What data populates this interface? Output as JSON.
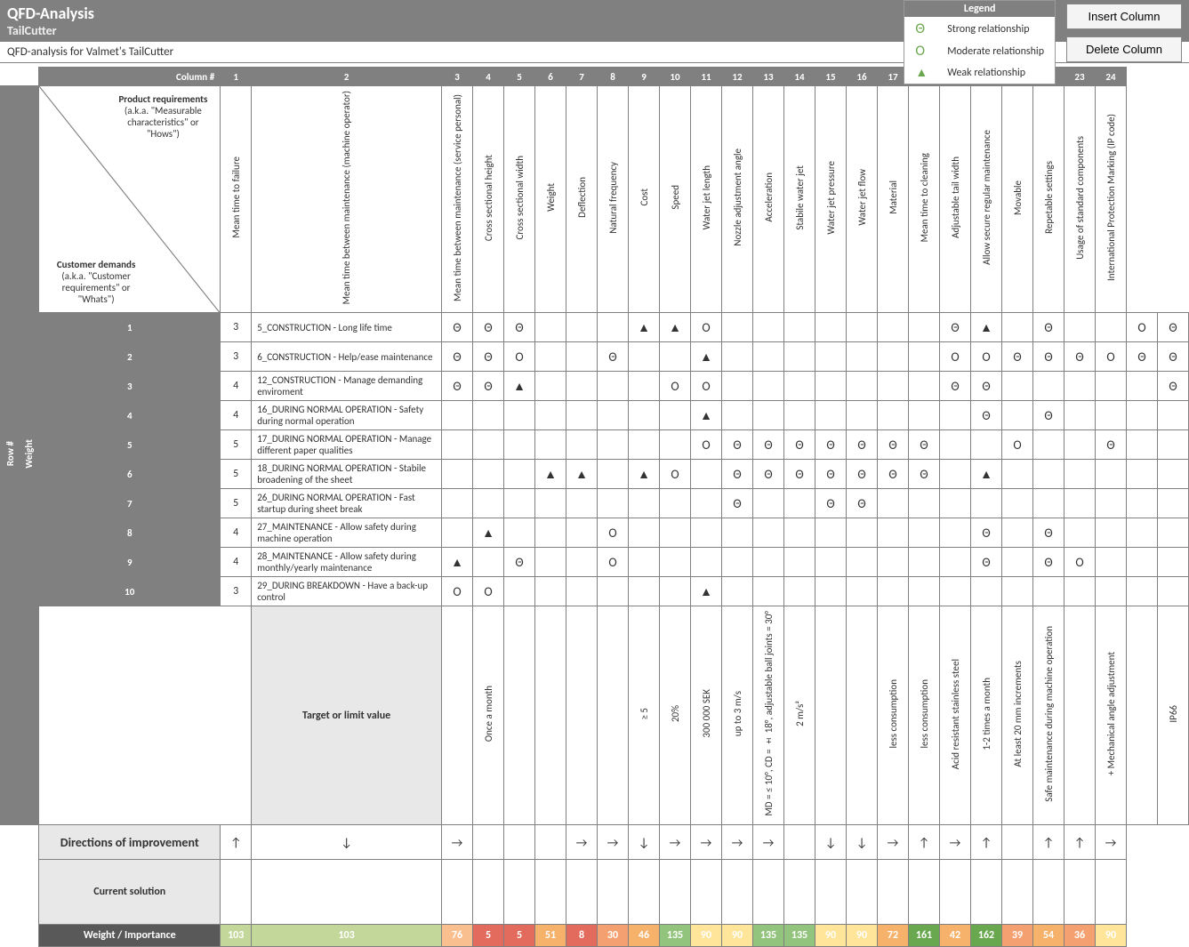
{
  "header": {
    "title": "QFD-Analysis",
    "subtitle": "TailCutter",
    "desc": "QFD-analysis for Valmet's TailCutter"
  },
  "buttons": {
    "insert": "Insert Column",
    "delete": "Delete Column"
  },
  "legend": {
    "title": "Legend",
    "strong": "Strong relationship",
    "moderate": "Moderate relationship",
    "weak": "Weak relationship"
  },
  "cornerLabels": {
    "productReq": "Product requirements",
    "productReqSub": "(a.k.a. \"Measurable characteristics\" or \"Hows\")",
    "custDem": "Customer demands",
    "custDemSub": "(a.k.a. \"Customer requirements\" or \"Whats\")"
  },
  "axis": {
    "columnNum": "Column #",
    "rowNum": "Row #",
    "weight": "Weight"
  },
  "rowLabels": {
    "target": "Target or limit value",
    "direction": "Directions of improvement",
    "current": "Current solution",
    "importance": "Weight / Importance"
  },
  "symbols": {
    "strong": "Θ",
    "moderate": "Ο",
    "weak": "▲"
  },
  "columns": [
    {
      "n": 1,
      "name": "Mean time to failure",
      "target": "",
      "dir": "↑",
      "imp": 103,
      "clr": "#c4d79b"
    },
    {
      "n": 2,
      "name": "Mean time between maintenance (machine operator)",
      "target": "Once a month",
      "dir": "↓",
      "imp": 103,
      "clr": "#c4d79b"
    },
    {
      "n": 3,
      "name": "Mean time between maintenance (service personal)",
      "target": "",
      "dir": "→",
      "imp": 76,
      "clr": "#fabf8f"
    },
    {
      "n": 4,
      "name": "Cross sectional height",
      "target": "",
      "dir": "",
      "imp": 5,
      "clr": "#e26b5d"
    },
    {
      "n": 5,
      "name": "Cross sectional width",
      "target": "",
      "dir": "",
      "imp": 5,
      "clr": "#e26b5d"
    },
    {
      "n": 6,
      "name": "Weight",
      "target": "",
      "dir": "",
      "imp": 51,
      "clr": "#f6b26b"
    },
    {
      "n": 7,
      "name": "Deflection",
      "target": "≥ 5",
      "dir": "→",
      "imp": 8,
      "clr": "#e26b5d"
    },
    {
      "n": 8,
      "name": "Natural frequency",
      "target": "20%",
      "dir": "→",
      "imp": 30,
      "clr": "#f4a070"
    },
    {
      "n": 9,
      "name": "Cost",
      "target": "300 000 SEK",
      "dir": "↓",
      "imp": 46,
      "clr": "#f6b26b"
    },
    {
      "n": 10,
      "name": "Speed",
      "target": "up to 3 m/s",
      "dir": "→",
      "imp": 135,
      "clr": "#93c47d"
    },
    {
      "n": 11,
      "name": "Water jet length",
      "target": "MD = ≤ 10°, CD = ± 18°, adjustable ball joints = 30°",
      "dir": "→",
      "imp": 90,
      "clr": "#ffe599"
    },
    {
      "n": 12,
      "name": "Nozzle adjustment angle",
      "target": "2 m/s²",
      "dir": "→",
      "imp": 90,
      "clr": "#ffe599"
    },
    {
      "n": 13,
      "name": "Acceleration",
      "target": "",
      "dir": "→",
      "imp": 135,
      "clr": "#93c47d"
    },
    {
      "n": 14,
      "name": "Stabile water jet",
      "target": "",
      "dir": "",
      "imp": 135,
      "clr": "#93c47d"
    },
    {
      "n": 15,
      "name": "Water jet pressure",
      "target": "less consumption",
      "dir": "↓",
      "imp": 90,
      "clr": "#ffe599"
    },
    {
      "n": 16,
      "name": "Water jet flow",
      "target": "less consumption",
      "dir": "↓",
      "imp": 90,
      "clr": "#ffe599"
    },
    {
      "n": 17,
      "name": "Material",
      "target": "Acid resistant stainless steel",
      "dir": "→",
      "imp": 72,
      "clr": "#f6b26b"
    },
    {
      "n": 18,
      "name": "Mean time to cleaning",
      "target": "1-2 times a month",
      "dir": "↑",
      "imp": 161,
      "clr": "#6aa84f"
    },
    {
      "n": 19,
      "name": "Adjustable tail width",
      "target": "At least 20 mm increments",
      "dir": "→",
      "imp": 42,
      "clr": "#f6b26b"
    },
    {
      "n": 20,
      "name": "Allow secure regular maintenance",
      "target": "Safe maintenance during machine operation",
      "dir": "↑",
      "imp": 162,
      "clr": "#6aa84f"
    },
    {
      "n": 21,
      "name": "Movable",
      "target": "",
      "dir": "",
      "imp": 39,
      "clr": "#f4a070"
    },
    {
      "n": 22,
      "name": "Repetable settings",
      "target": "+ Mechanical angle adjustment",
      "dir": "↑",
      "imp": 54,
      "clr": "#f6b26b"
    },
    {
      "n": 23,
      "name": "Usage of standard components",
      "target": "",
      "dir": "↑",
      "imp": 36,
      "clr": "#f4a070"
    },
    {
      "n": 24,
      "name": "International Protection Marking (IP code)",
      "target": "IP66",
      "dir": "→",
      "imp": 90,
      "clr": "#ffe599"
    }
  ],
  "rows": [
    {
      "n": 1,
      "w": 3,
      "name": "5_CONSTRUCTION - Long life time",
      "r": {
        "1": "s",
        "2": "s",
        "3": "s",
        "7": "w",
        "8": "w",
        "9": "m",
        "17": "s",
        "18": "w",
        "20": "s",
        "23": "m",
        "24": "s"
      }
    },
    {
      "n": 2,
      "w": 3,
      "name": "6_CONSTRUCTION - Help/ease maintenance",
      "r": {
        "1": "s",
        "2": "s",
        "3": "m",
        "6": "s",
        "9": "w",
        "17": "m",
        "18": "m",
        "19": "s",
        "20": "s",
        "21": "s",
        "22": "m",
        "23": "s",
        "24": "s"
      }
    },
    {
      "n": 3,
      "w": 4,
      "name": "12_CONSTRUCTION - Manage demanding enviroment",
      "r": {
        "1": "s",
        "2": "s",
        "3": "w",
        "8": "m",
        "9": "m",
        "17": "s",
        "18": "s",
        "24": "s"
      }
    },
    {
      "n": 4,
      "w": 4,
      "name": "16_DURING NORMAL OPERATION - Safety during normal operation",
      "r": {
        "9": "w",
        "18": "s",
        "20": "s"
      }
    },
    {
      "n": 5,
      "w": 5,
      "name": "17_DURING NORMAL OPERATION - Manage different paper qualities",
      "r": {
        "9": "m",
        "10": "s",
        "11": "s",
        "12": "s",
        "13": "s",
        "14": "s",
        "15": "s",
        "16": "s",
        "19": "m",
        "22": "s"
      }
    },
    {
      "n": 6,
      "w": 5,
      "name": "18_DURING NORMAL OPERATION - Stabile broadening of the sheet",
      "r": {
        "4": "w",
        "5": "w",
        "7": "w",
        "8": "m",
        "10": "s",
        "11": "s",
        "12": "s",
        "13": "s",
        "14": "s",
        "15": "s",
        "16": "s",
        "18": "w"
      }
    },
    {
      "n": 7,
      "w": 5,
      "name": "26_DURING NORMAL OPERATION - Fast startup during sheet break",
      "r": {
        "10": "s",
        "13": "s",
        "14": "s"
      }
    },
    {
      "n": 8,
      "w": 4,
      "name": "27_MAINTENANCE - Allow safety during machine operation",
      "r": {
        "2": "w",
        "6": "m",
        "18": "s",
        "20": "s"
      }
    },
    {
      "n": 9,
      "w": 4,
      "name": "28_MAINTENANCE - Allow safety during monthly/yearly maintenance",
      "r": {
        "1": "w",
        "3": "s",
        "6": "m",
        "18": "s",
        "20": "s",
        "21": "m"
      }
    },
    {
      "n": 10,
      "w": 3,
      "name": "29_DURING BREAKDOWN - Have a back-up control",
      "r": {
        "1": "m",
        "2": "m",
        "9": "w"
      }
    }
  ]
}
